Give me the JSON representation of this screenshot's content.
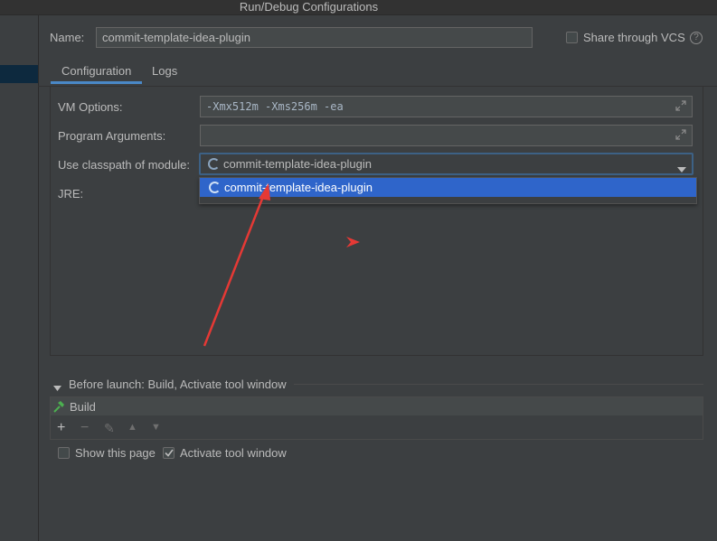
{
  "window": {
    "title": "Run/Debug Configurations"
  },
  "name_row": {
    "label": "Name:",
    "value": "commit-template-idea-plugin",
    "share_label": "Share through VCS",
    "share_checked": false,
    "help_glyph": "?"
  },
  "tabs": [
    {
      "label": "Configuration",
      "active": true
    },
    {
      "label": "Logs",
      "active": false
    }
  ],
  "config": {
    "vm_options_label": "VM Options:",
    "vm_options_value": "-Xmx512m -Xms256m -ea",
    "program_args_label": "Program Arguments:",
    "program_args_value": "",
    "classpath_label": "Use classpath of module:",
    "classpath_value": "commit-template-idea-plugin",
    "jre_label": "JRE:",
    "dropdown_options": [
      "commit-template-idea-plugin"
    ]
  },
  "before_launch": {
    "title": "Before launch: Build, Activate tool window",
    "items": [
      "Build"
    ],
    "toolbar": [
      "+",
      "−",
      "✎",
      "▲",
      "▼"
    ]
  },
  "footer": {
    "show_page_label": "Show this page",
    "show_page_checked": false,
    "activate_label": "Activate tool window",
    "activate_checked": true
  },
  "colors": {
    "background": "#3c3f41",
    "selection": "#2f65ca",
    "focus_border": "#3d6185",
    "tab_underline": "#4a88c7",
    "annotation_arrow": "#e53935",
    "build_icon": "#4caf50"
  },
  "icons": [
    "expand-icon",
    "module-icon",
    "chevron-down-icon",
    "collapse-triangle-icon",
    "hammer-icon",
    "help-icon",
    "checkmark-icon"
  ]
}
